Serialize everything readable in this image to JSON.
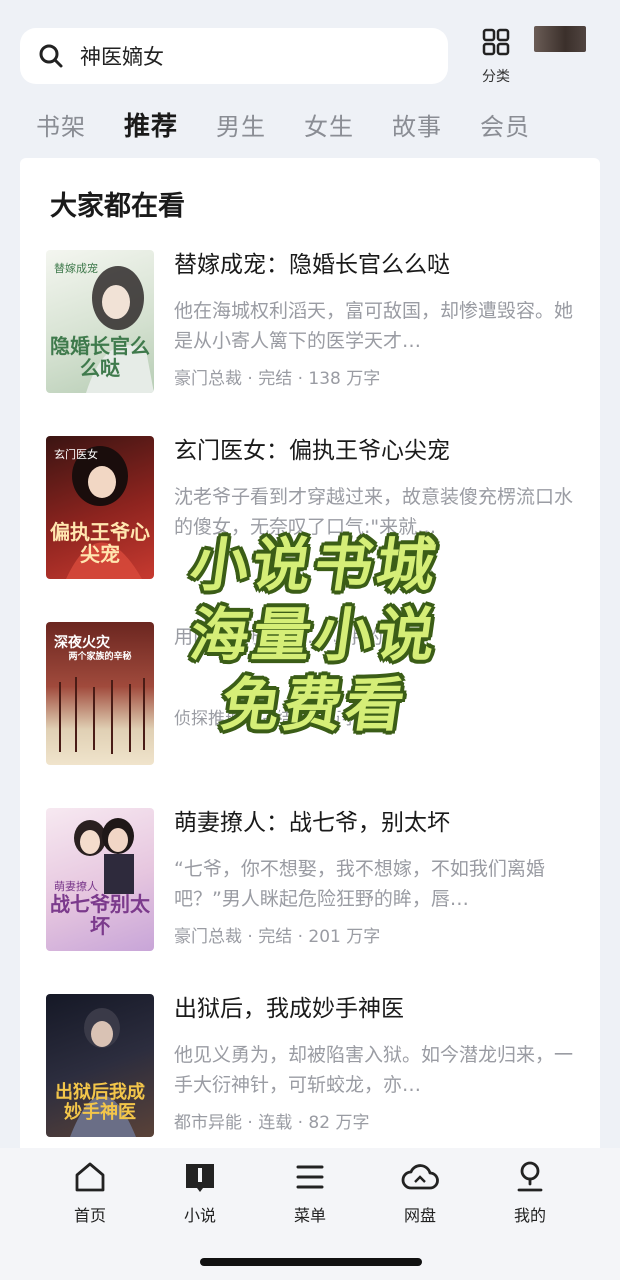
{
  "search": {
    "query": "神医嫡女"
  },
  "category": {
    "label": "分类"
  },
  "tabs": [
    {
      "label": "书架",
      "active": false
    },
    {
      "label": "推荐",
      "active": true
    },
    {
      "label": "男生",
      "active": false
    },
    {
      "label": "女生",
      "active": false
    },
    {
      "label": "故事",
      "active": false
    },
    {
      "label": "会员",
      "active": false
    }
  ],
  "section": {
    "title": "大家都在看"
  },
  "books": [
    {
      "title": "替嫁成宠：隐婚长官么么哒",
      "desc": "他在海城权利滔天，富可敌国，却惨遭毁容。她是从小寄人篱下的医学天才…",
      "meta": "豪门总裁 · 完结 · 138 万字",
      "cover_text": "隐婚长官么么哒",
      "cover_top": "替嫁成宠",
      "cover_colors": [
        "#e9efe6",
        "#c9d8c4"
      ],
      "cover_text_color": "#3f7a4c"
    },
    {
      "title": "玄门医女：偏执王爷心尖宠",
      "desc": "沈老爷子看到才穿越过来，故意装傻充楞流口水的傻女，无奈叹了口气:\"来就…",
      "meta": "",
      "cover_text": "偏执王爷心尖宠",
      "cover_top": "玄门医女",
      "cover_colors": [
        "#5a1e1a",
        "#b8332c"
      ],
      "cover_text_color": "#ffe6b0"
    },
    {
      "title": "",
      "desc": "用两个家族…，…动手的…",
      "meta": "侦探推理 · 完结 · 2 万字",
      "cover_text": "深夜火灾",
      "cover_top": "两个家族的辛秘",
      "cover_colors": [
        "#7a2a22",
        "#d9c6a8"
      ],
      "cover_text_color": "#ffffff"
    },
    {
      "title": "萌妻撩人：战七爷，别太坏",
      "desc": "“七爷，你不想娶，我不想嫁，不如我们离婚吧？”男人眯起危险狂野的眸，唇…",
      "meta": "豪门总裁 · 完结 · 201 万字",
      "cover_text": "战七爷别太坏",
      "cover_top": "萌妻撩人",
      "cover_colors": [
        "#f1dbe9",
        "#c7a2d4"
      ],
      "cover_text_color": "#7b3a8c"
    },
    {
      "title": "出狱后，我成妙手神医",
      "desc": "他见义勇为，却被陷害入狱。如今潜龙归来，一手大衍神针，可斩蛟龙，亦…",
      "meta": "都市异能 · 连载 · 82 万字",
      "cover_text": "出狱后我成妙手神医",
      "cover_top": "",
      "cover_colors": [
        "#1b1e2c",
        "#4a3f3a"
      ],
      "cover_text_color": "#f3c64a"
    }
  ],
  "promo": {
    "line1": "小说书城",
    "line2": "海量小说",
    "line3": "免费看"
  },
  "nav": [
    {
      "label": "首页",
      "icon": "home-icon"
    },
    {
      "label": "小说",
      "icon": "book-icon"
    },
    {
      "label": "菜单",
      "icon": "menu-icon"
    },
    {
      "label": "网盘",
      "icon": "cloud-icon"
    },
    {
      "label": "我的",
      "icon": "user-icon"
    }
  ]
}
